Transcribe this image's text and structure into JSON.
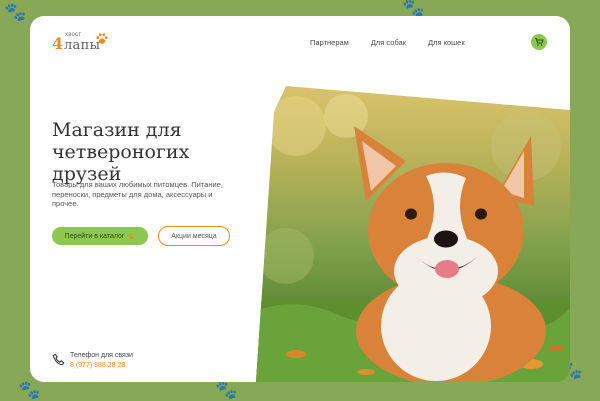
{
  "logo": {
    "small": "хвост",
    "big": "лапы",
    "four": "4"
  },
  "nav": [
    {
      "label": "Партнерам"
    },
    {
      "label": "Для собак"
    },
    {
      "label": "Для кошек"
    }
  ],
  "hero": {
    "title_line1": "Магазин для",
    "title_line2": "четвероногих друзей",
    "description": "Товары для ваших любимых питомцев. Питание, переноски, предметы для дома, аксессуары и прочее.",
    "cta_primary": "Перейти в каталог",
    "cta_secondary": "Акции месяца"
  },
  "contact": {
    "label": "Телефон для связи",
    "phone": "8 (977) 888 28 28"
  },
  "colors": {
    "accent": "#8cc850",
    "orange": "#ef8a1f",
    "background": "#86a857"
  },
  "icons": {
    "cart": "cart-icon",
    "phone": "phone-icon",
    "paw": "paw-icon"
  }
}
